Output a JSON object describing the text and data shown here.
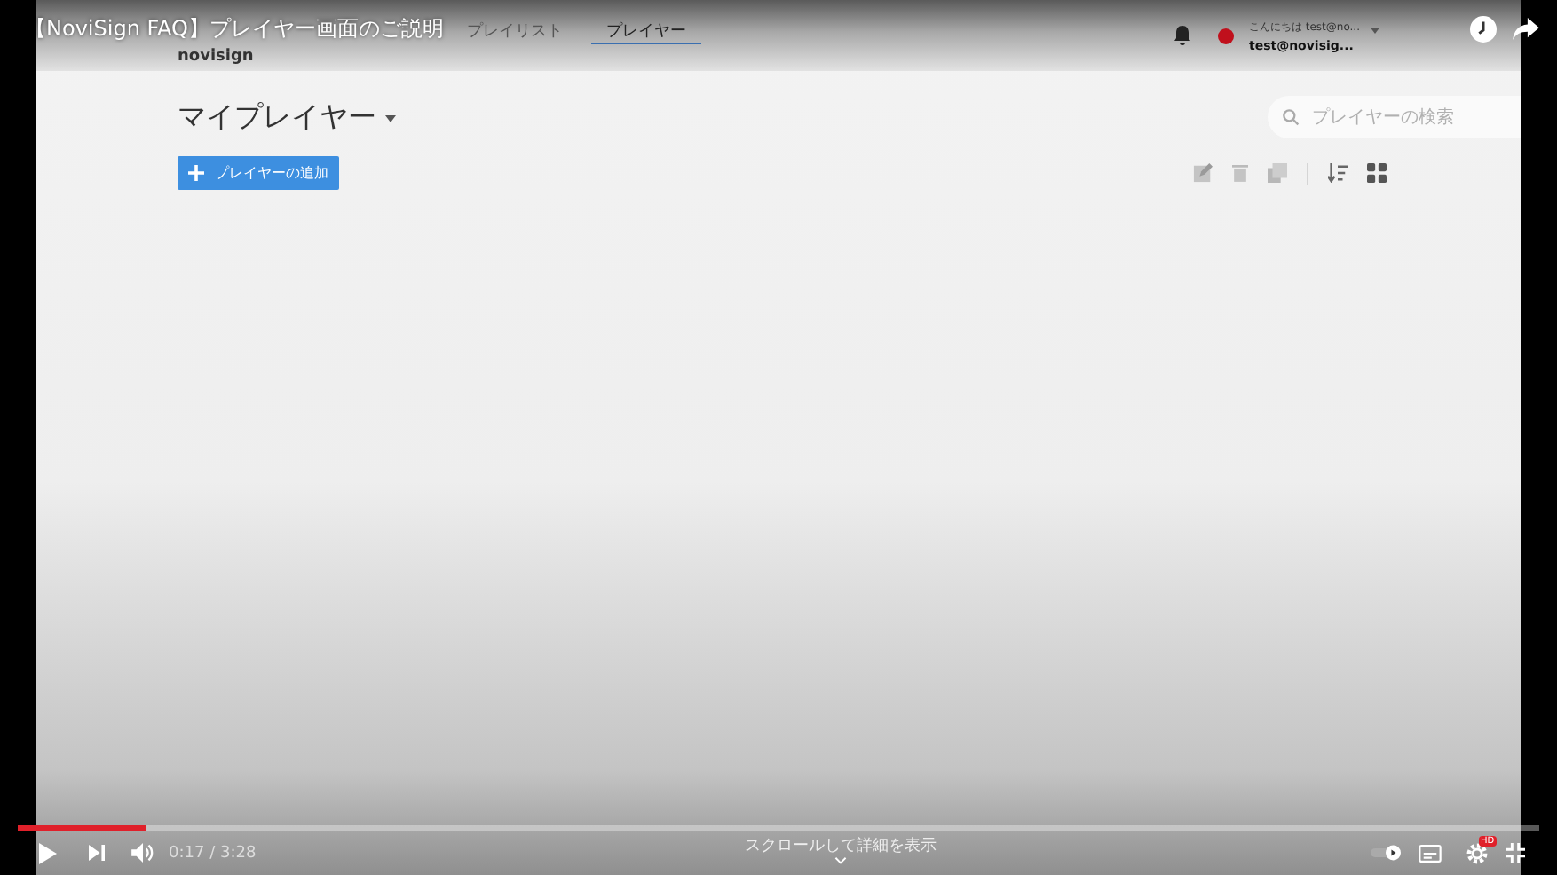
{
  "video_title": "【NoviSign FAQ】プレイヤー画面のご説明",
  "app": {
    "logo": "novisign",
    "nav_tabs": [
      {
        "label": "プレイリスト",
        "selected": false
      },
      {
        "label": "プレイヤー",
        "selected": true
      }
    ],
    "user": {
      "greeting": "こんにちは test@no...",
      "account": "test@novisig..."
    },
    "heading": "マイプレイヤー",
    "add_button": "プレイヤーの追加",
    "search": {
      "placeholder": "プレイヤーの検索"
    }
  },
  "player": {
    "progress": {
      "level": 0.084
    },
    "time": "0:17 / 3:28",
    "scroll_hint": "スクロールして詳細を表示",
    "hd_badge": "HD"
  }
}
